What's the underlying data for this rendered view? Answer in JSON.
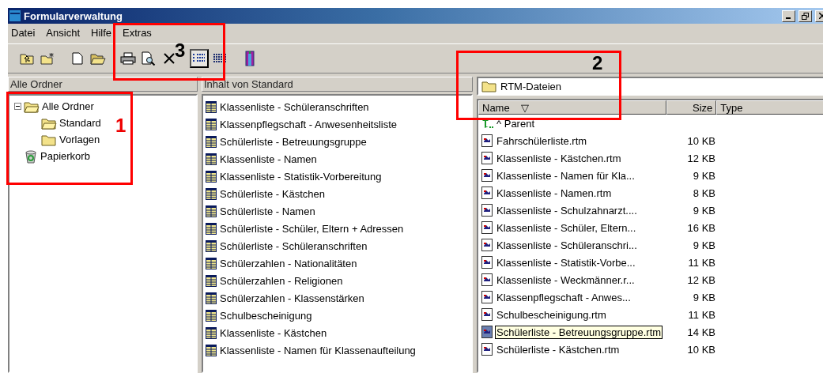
{
  "window": {
    "title": "Formularverwaltung"
  },
  "menu": [
    "Datei",
    "Ansicht",
    "Hilfe",
    "Extras"
  ],
  "toolbar": [
    {
      "kind": "up",
      "pressed": false
    },
    {
      "kind": "newfolder",
      "pressed": false
    },
    {
      "kind": "new",
      "pressed": false
    },
    {
      "kind": "open",
      "pressed": false
    },
    {
      "kind": "print",
      "pressed": false
    },
    {
      "kind": "preview",
      "pressed": false
    },
    {
      "kind": "delete",
      "pressed": false
    },
    {
      "kind": "details",
      "pressed": true
    },
    {
      "kind": "list",
      "pressed": false
    },
    {
      "kind": "exit",
      "pressed": false
    }
  ],
  "tree": {
    "header": "Alle Ordner",
    "items": [
      {
        "label": "Alle Ordner",
        "kind": "openfolder",
        "expanded": true,
        "children": [
          {
            "label": "Standard",
            "kind": "openfolder"
          },
          {
            "label": "Vorlagen",
            "kind": "folder"
          }
        ]
      },
      {
        "label": "Papierkorb",
        "kind": "trash"
      }
    ]
  },
  "content": {
    "header": "Inhalt von Standard",
    "items": [
      "Klassenliste - Schüleranschriften",
      "Klassenpflegschaft - Anwesenheitsliste",
      "Schülerliste - Betreuungsgruppe",
      "Klassenliste - Namen",
      "Klassenliste - Statistik-Vorbereitung",
      "Schülerliste - Kästchen",
      "Schülerliste - Namen",
      "Schülerliste - Schüler, Eltern + Adressen",
      "Schülerliste - Schüleranschriften",
      "Schülerzahlen - Nationalitäten",
      "Schülerzahlen - Religionen",
      "Schülerzahlen - Klassenstärken",
      "Schulbescheinigung",
      "Klassenliste - Kästchen",
      "Klassenliste - Namen für Klassenaufteilung"
    ]
  },
  "files": {
    "folder": "RTM-Dateien",
    "columns": [
      "Name",
      "Size",
      "Type"
    ],
    "sort_mark": "▽",
    "parent": "^ Parent",
    "rows": [
      {
        "name": "Fahrschülerliste.rtm",
        "size": "10 KB",
        "selected": false
      },
      {
        "name": "Klassenliste - Kästchen.rtm",
        "size": "12 KB",
        "selected": false
      },
      {
        "name": "Klassenliste - Namen für Kla...",
        "size": "9 KB",
        "selected": false
      },
      {
        "name": "Klassenliste - Namen.rtm",
        "size": "8 KB",
        "selected": false
      },
      {
        "name": "Klassenliste - Schulzahnarzt....",
        "size": "9 KB",
        "selected": false
      },
      {
        "name": "Klassenliste - Schüler, Eltern...",
        "size": "16 KB",
        "selected": false
      },
      {
        "name": "Klassenliste - Schüleranschri...",
        "size": "9 KB",
        "selected": false
      },
      {
        "name": "Klassenliste - Statistik-Vorbe...",
        "size": "11 KB",
        "selected": false
      },
      {
        "name": "Klassenliste - Weckmänner.r...",
        "size": "12 KB",
        "selected": false
      },
      {
        "name": "Klassenpflegschaft - Anwes...",
        "size": "9 KB",
        "selected": false
      },
      {
        "name": "Schulbescheinigung.rtm",
        "size": "11 KB",
        "selected": false
      },
      {
        "name": "Schülerliste - Betreuungsgruppe.rtm",
        "size": "14 KB",
        "selected": true
      },
      {
        "name": "Schülerliste - Kästchen.rtm",
        "size": "10 KB",
        "selected": false
      }
    ]
  },
  "annotations": [
    {
      "label": "1"
    },
    {
      "label": "2"
    },
    {
      "label": "3"
    }
  ]
}
